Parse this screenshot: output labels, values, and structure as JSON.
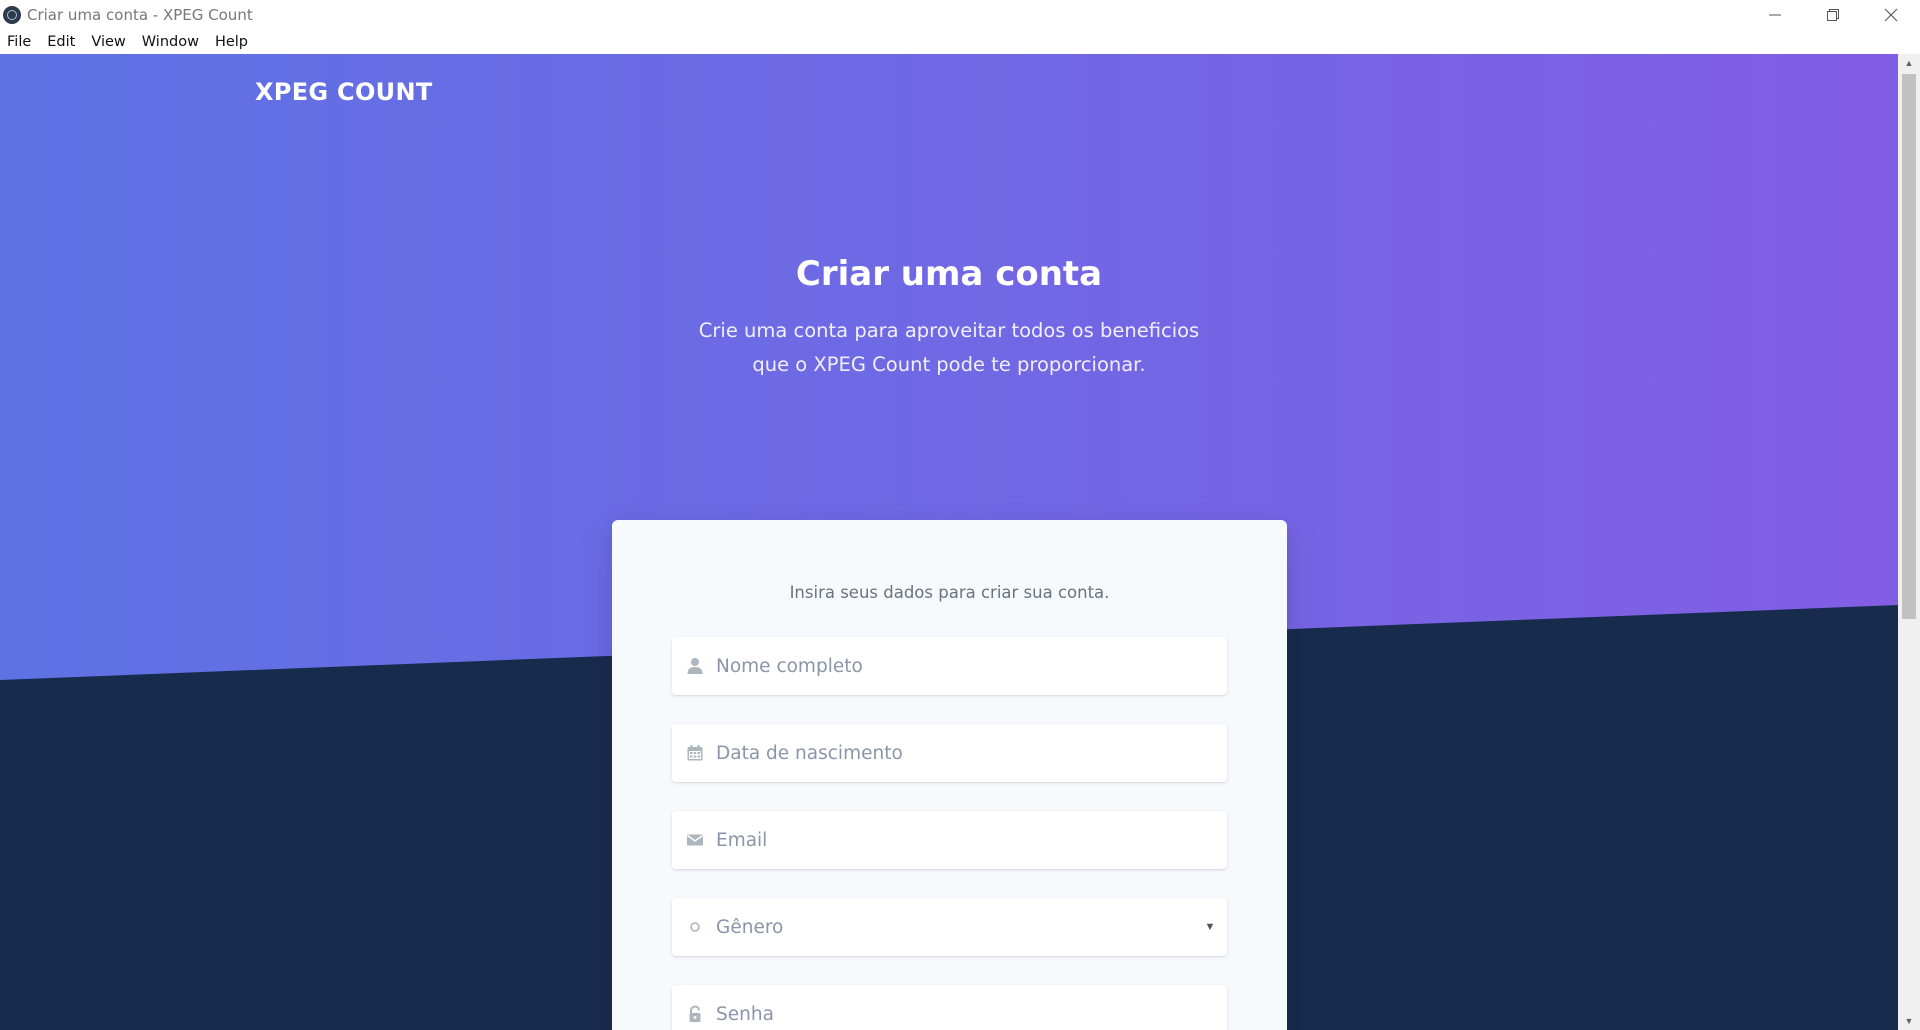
{
  "window": {
    "title": "Criar uma conta - XPEG Count",
    "controls": [
      "minimize-icon",
      "restore-icon",
      "close-icon"
    ]
  },
  "menu": {
    "items": [
      "File",
      "Edit",
      "View",
      "Window",
      "Help"
    ]
  },
  "colors": {
    "gradient_start": "#5e72e4",
    "gradient_end": "#825ee4",
    "dark_section": "#172b4d",
    "card_bg": "#f7fafc"
  },
  "header": {
    "brand": "XPEG COUNT"
  },
  "hero": {
    "title": "Criar uma conta",
    "subtitle_line1": "Crie uma conta para aproveitar todos os beneficios",
    "subtitle_line2": "que o XPEG Count pode te proporcionar."
  },
  "form": {
    "lead": "Insira seus dados para criar sua conta.",
    "fields": [
      {
        "icon": "user-icon",
        "placeholder": "Nome completo",
        "value": ""
      },
      {
        "icon": "calendar-icon",
        "placeholder": "Data de nascimento",
        "value": ""
      },
      {
        "icon": "envelope-icon",
        "placeholder": "Email",
        "value": ""
      },
      {
        "icon": "circle-icon",
        "placeholder": "Gênero",
        "value": ""
      },
      {
        "icon": "lock-icon",
        "placeholder": "Senha",
        "value": ""
      }
    ]
  }
}
